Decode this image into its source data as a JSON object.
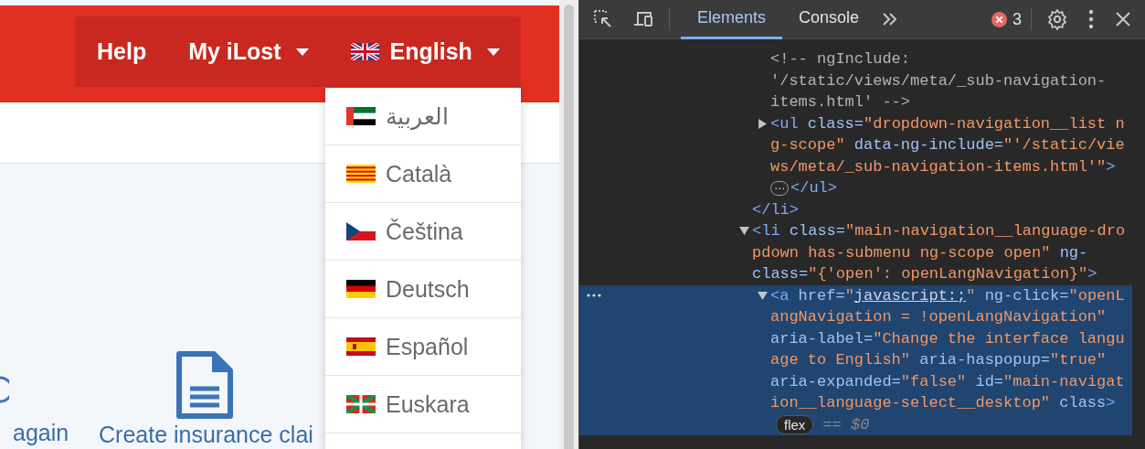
{
  "browser_page": {
    "nav": [
      {
        "label": "Help",
        "has_menu": false
      },
      {
        "label": "My iLost",
        "has_menu": true
      },
      {
        "label": "English",
        "has_menu": true,
        "kind": "uk"
      }
    ],
    "language_menu": [
      {
        "label": "العربية",
        "kind": "ae"
      },
      {
        "label": "Català",
        "kind": "catalonia"
      },
      {
        "label": "Čeština",
        "kind": "cz"
      },
      {
        "label": "Deutsch",
        "kind": "de"
      },
      {
        "label": "Español",
        "kind": "es"
      },
      {
        "label": "Euskara",
        "kind": "basque"
      }
    ],
    "content": {
      "partial_link": "again",
      "insurance_link": "Create insurance clai"
    }
  },
  "devtools": {
    "tabs": [
      {
        "label": "Elements",
        "selected": true
      },
      {
        "label": "Console",
        "selected": false
      }
    ],
    "error_count": "3",
    "dom_tree": [
      {
        "children": [
          {
            "lines": [
              {
                "tokens": [
                  {
                    "kind": "comment",
                    "s": "<!-- ngInclude:"
                  }
                ]
              },
              {
                "tokens": [
                  {
                    "kind": "comment",
                    "s": "'/static/views/meta/_sub-navigation-"
                  }
                ]
              },
              {
                "tokens": [
                  {
                    "kind": "comment",
                    "s": "items.html' -->"
                  }
                ]
              }
            ]
          },
          {
            "expanded": false,
            "selected": false,
            "lines": [
              {
                "tokens": [
                  {
                    "kind": "tag",
                    "s": "<ul"
                  },
                  {
                    "kind": "attr",
                    "s": " class="
                  },
                  {
                    "kind": "val",
                    "s": "\"dropdown-navigation__list n"
                  }
                ]
              },
              {
                "tokens": [
                  {
                    "kind": "val",
                    "s": "g-scope\""
                  },
                  {
                    "kind": "attr",
                    "s": " data-ng-include="
                  },
                  {
                    "kind": "val",
                    "s": "\"'/static/vie"
                  }
                ]
              },
              {
                "tokens": [
                  {
                    "kind": "val",
                    "s": "ws/meta/_sub-navigation-items.html'\""
                  },
                  {
                    "kind": "tag",
                    "s": ">"
                  }
                ]
              }
            ],
            "close_lines": [
              {
                "ellipsis": "⋯",
                "tokens": [
                  {
                    "kind": "tag",
                    "s": "</ul>"
                  }
                ]
              }
            ]
          }
        ],
        "close_lines": [
          {
            "tokens": [
              {
                "kind": "tag",
                "s": "</li>"
              }
            ]
          }
        ]
      },
      {
        "expanded": true,
        "selected": false,
        "lines": [
          {
            "tokens": [
              {
                "kind": "tag",
                "s": "<li"
              },
              {
                "kind": "attr",
                "s": " class="
              },
              {
                "kind": "val",
                "s": "\"main-navigation__language-dro"
              }
            ]
          },
          {
            "tokens": [
              {
                "kind": "val",
                "s": "pdown has-submenu ng-scope open\""
              },
              {
                "kind": "attr",
                "s": " ng-"
              }
            ]
          },
          {
            "tokens": [
              {
                "kind": "attr",
                "s": "class="
              },
              {
                "kind": "val",
                "s": "\"{'open': openLangNavigation}\""
              },
              {
                "kind": "tag",
                "s": ">"
              }
            ]
          }
        ],
        "children": [
          {
            "expanded": true,
            "selected": true,
            "lines": [
              {
                "tokens": [
                  {
                    "kind": "tag",
                    "s": "<a"
                  },
                  {
                    "kind": "attr",
                    "s": " href="
                  },
                  {
                    "kind": "val",
                    "s": "\""
                  },
                  {
                    "kind": "link",
                    "s": "javascript:;"
                  },
                  {
                    "kind": "val",
                    "s": "\""
                  },
                  {
                    "kind": "attr",
                    "s": " ng-click="
                  },
                  {
                    "kind": "val",
                    "s": "\"openL"
                  }
                ]
              },
              {
                "tokens": [
                  {
                    "kind": "val",
                    "s": "angNavigation = !openLangNavigation\""
                  }
                ]
              },
              {
                "tokens": [
                  {
                    "kind": "attr",
                    "s": "aria-label="
                  },
                  {
                    "kind": "val",
                    "s": "\"Change the interface langu"
                  }
                ]
              },
              {
                "tokens": [
                  {
                    "kind": "val",
                    "s": "age to English\""
                  },
                  {
                    "kind": "attr",
                    "s": " aria-haspopup="
                  },
                  {
                    "kind": "val",
                    "s": "\"true\""
                  }
                ]
              },
              {
                "tokens": [
                  {
                    "kind": "attr",
                    "s": "aria-expanded="
                  },
                  {
                    "kind": "val",
                    "s": "\"false\""
                  },
                  {
                    "kind": "attr",
                    "s": " id="
                  },
                  {
                    "kind": "val",
                    "s": "\"main-navigat"
                  }
                ]
              },
              {
                "tokens": [
                  {
                    "kind": "val",
                    "s": "ion__language-select__desktop\""
                  },
                  {
                    "kind": "attr",
                    "s": " class"
                  },
                  {
                    "kind": "tag",
                    "s": ">"
                  }
                ]
              },
              {
                "badge": "flex",
                "hint": "== $0"
              }
            ]
          }
        ]
      }
    ]
  }
}
